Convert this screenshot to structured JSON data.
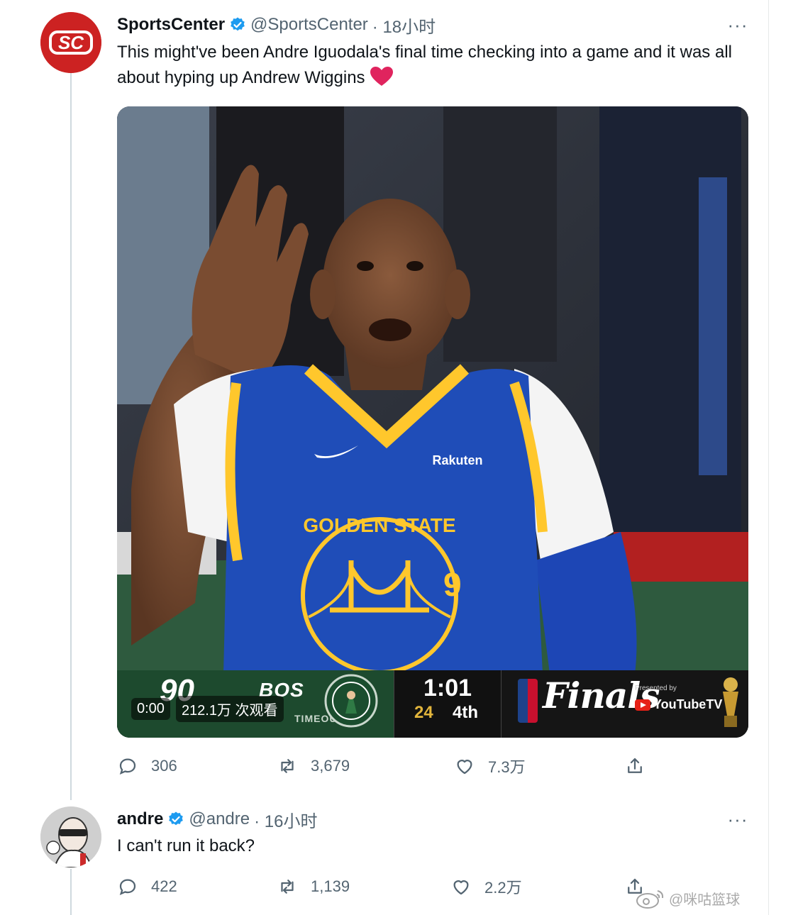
{
  "tweet": {
    "display_name": "SportsCenter",
    "handle": "@SportsCenter",
    "time": "· 18小时",
    "avatar_text": "SC",
    "more": "···",
    "text": "This might've been Andre Iguodala's final time checking into a game and it was all about hyping up Andrew Wiggins",
    "emoji_icon": "red-heart-emoji",
    "media": {
      "video_time": "0:00",
      "view_count": "212.1万 次观看",
      "scorebug": {
        "away_score": "90",
        "home_team": "BOS",
        "timeouts_label": "TIMEOUTS: 1",
        "game_clock": "1:01",
        "shot_clock": "24",
        "quarter": "4th",
        "event": "Finals",
        "presented_by": "Presented by",
        "sponsor": "YouTubeTV"
      },
      "jersey": {
        "team": "GOLDEN STATE",
        "number": "9",
        "sponsor": "Rakuten"
      }
    },
    "stats": {
      "replies": "306",
      "retweets": "3,679",
      "likes": "7.3万"
    }
  },
  "reply": {
    "display_name": "andre",
    "handle": "@andre",
    "time": "· 16小时",
    "more": "···",
    "text": "I can't run it back?",
    "stats": {
      "replies": "422",
      "retweets": "1,139",
      "likes": "2.2万"
    }
  },
  "watermark": {
    "text": "@咪咕篮球"
  },
  "colors": {
    "verified": "#1d9bf0",
    "secondary_text": "#536471",
    "warriors_blue": "#1d428a",
    "warriors_gold": "#ffc72c",
    "heart_red": "#e0245e"
  }
}
